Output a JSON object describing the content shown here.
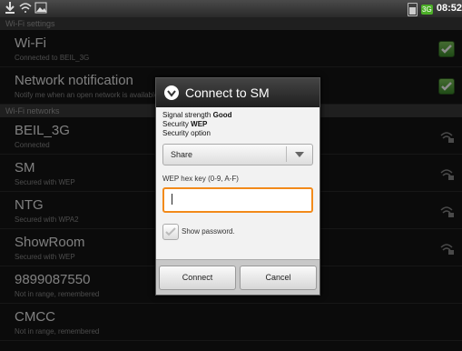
{
  "status_bar": {
    "time": "08:52",
    "notification_icons": [
      "download-icon",
      "wifi-settings-icon",
      "image-icon"
    ]
  },
  "sections": {
    "wifi_settings": "Wi-Fi settings",
    "wifi_networks": "Wi-Fi networks"
  },
  "settings_rows": [
    {
      "title": "Wi-Fi",
      "sub": "Connected to BEIL_3G",
      "checked": true
    },
    {
      "title": "Network notification",
      "sub": "Notify me when an open network is available",
      "checked": true
    }
  ],
  "networks": [
    {
      "title": "BEIL_3G",
      "sub": "Connected",
      "icon": "wifi-lock-icon"
    },
    {
      "title": "SM",
      "sub": "Secured with WEP",
      "icon": "wifi-lock-icon"
    },
    {
      "title": "NTG",
      "sub": "Secured with WPA2",
      "icon": "wifi-lock-icon"
    },
    {
      "title": "ShowRoom",
      "sub": "Secured with WEP",
      "icon": "wifi-lock-icon"
    },
    {
      "title": "9899087550",
      "sub": "Not in range, remembered"
    },
    {
      "title": "CMCC",
      "sub": "Not in range, remembered"
    }
  ],
  "dialog": {
    "title": "Connect to SM",
    "signal_label": "Signal strength",
    "signal_value": "Good",
    "security_label": "Security",
    "security_value": "WEP",
    "security_option_label": "Security option",
    "security_option_value": "Share",
    "hex_label": "WEP hex key (0-9, A-F)",
    "hex_value": "",
    "show_password": "Show password.",
    "connect": "Connect",
    "cancel": "Cancel"
  },
  "colors": {
    "accent": "#f28a1a",
    "check": "#5aaa3a"
  }
}
